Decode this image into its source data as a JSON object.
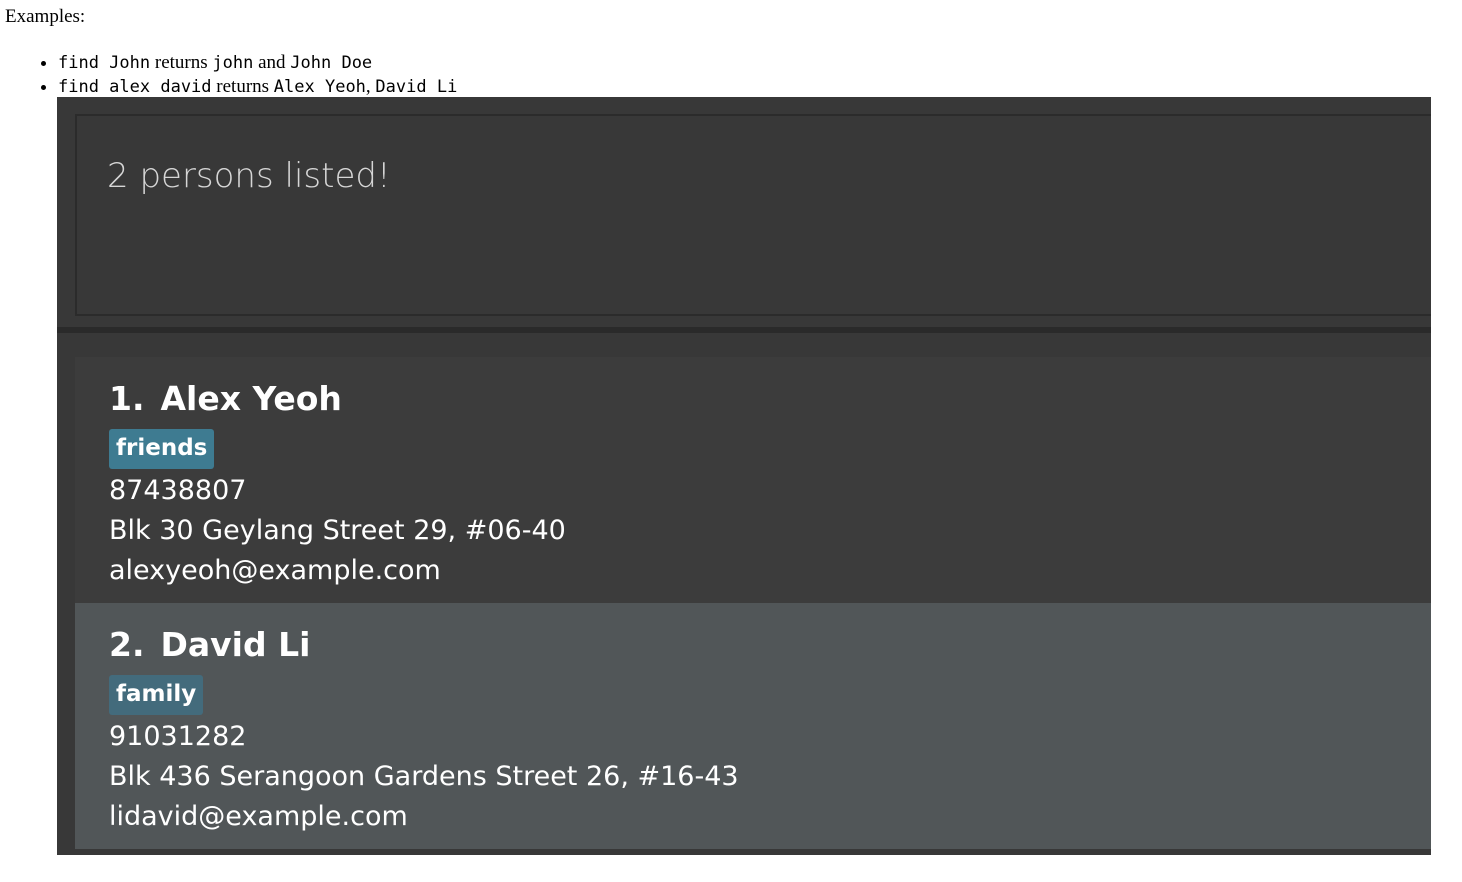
{
  "doc": {
    "heading": "Examples:",
    "examples": [
      {
        "cmd": "find John",
        "mid": " returns ",
        "r1": "john",
        "sep": " and ",
        "r2": "John Doe"
      },
      {
        "cmd": "find alex david",
        "mid": " returns ",
        "r1": "Alex Yeoh",
        "sep": ", ",
        "r2": "David Li"
      }
    ]
  },
  "app": {
    "result_message": "2 persons listed!",
    "persons": [
      {
        "index": "1.",
        "name": "Alex Yeoh",
        "tag": "friends",
        "phone": "87438807",
        "address": "Blk 30 Geylang Street 29, #06-40",
        "email": "alexyeoh@example.com"
      },
      {
        "index": "2.",
        "name": "David Li",
        "tag": "family",
        "phone": "91031282",
        "address": "Blk 436 Serangoon Gardens Street 26, #16-43",
        "email": "lidavid@example.com"
      }
    ],
    "colors": {
      "background": "#383838",
      "card_selected": "#515658",
      "tag": "#3e7b91"
    }
  }
}
